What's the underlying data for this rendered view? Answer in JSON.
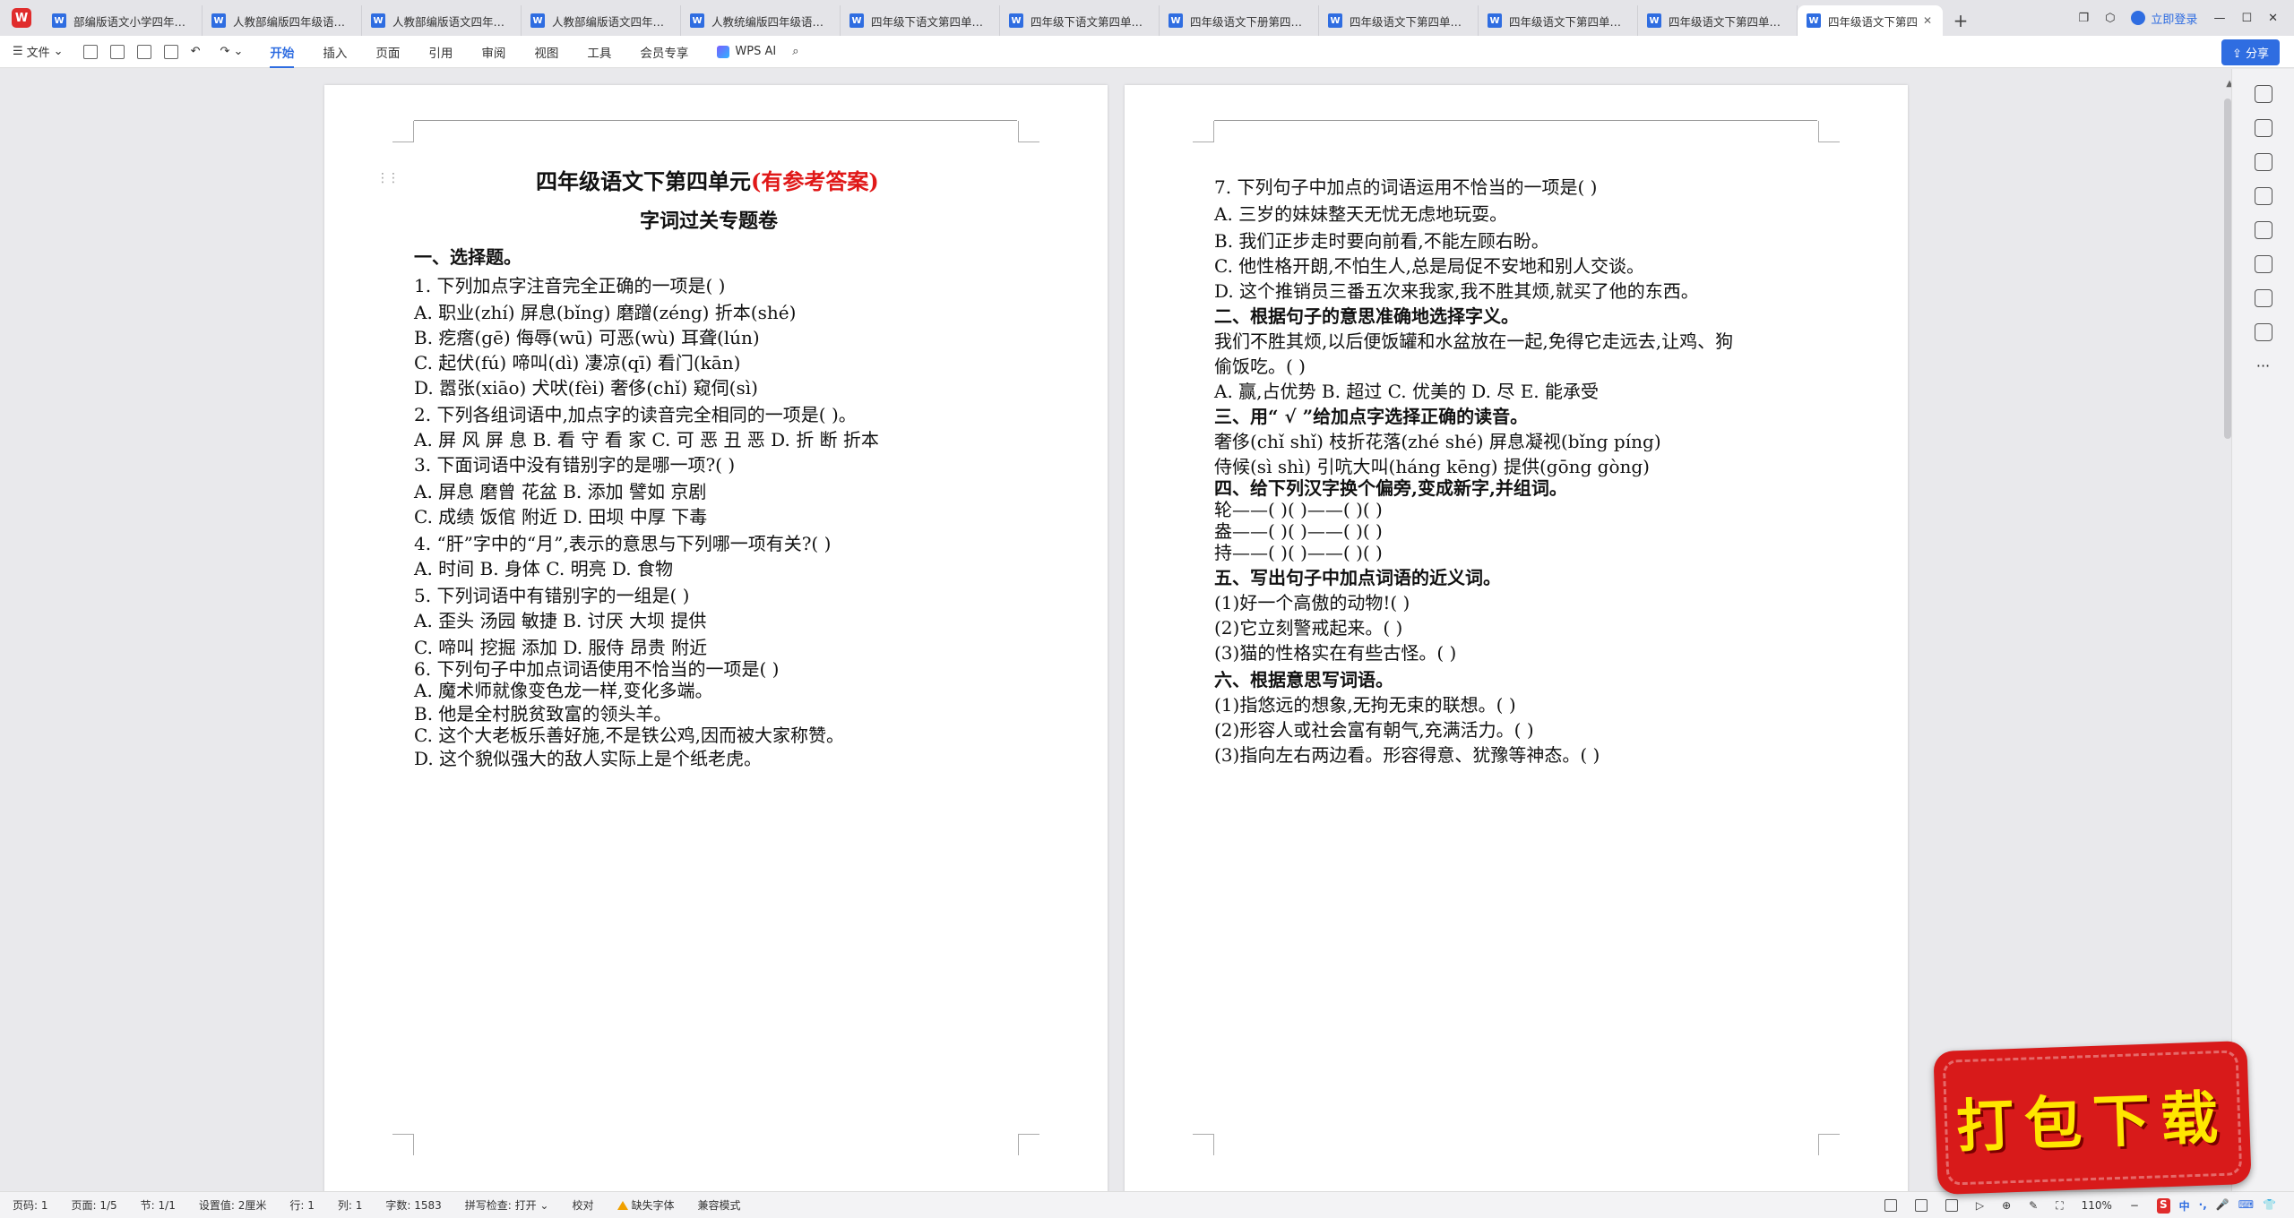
{
  "tabs": [
    "部编版语文小学四年级下",
    "人教部编版四年级语文下",
    "人教部编版语文四年级下",
    "人教部编版语文四年级下",
    "人教统编版四年级语文下",
    "四年级下语文第四单元字",
    "四年级下语文第四单元综",
    "四年级语文下册第四单元",
    "四年级语文下第四单元综",
    "四年级语文下第四单元课",
    "四年级语文下第四单元课"
  ],
  "active_tab": "四年级语文下第四",
  "tabbar_right": {
    "login": "立即登录"
  },
  "toolbar": {
    "file": "文件",
    "menus": [
      "开始",
      "插入",
      "页面",
      "引用",
      "审阅",
      "视图",
      "工具",
      "会员专享"
    ],
    "wps_ai": "WPS AI",
    "share": "分享"
  },
  "page1": {
    "title_main": "四年级语文下第四单元",
    "title_red": "(有参考答案)",
    "subtitle": "字词过关专题卷",
    "lines": [
      "一、选择题。",
      "1. 下列加点字注音完全正确的一项是(          )",
      "A. 职业(zhí)    屏息(bǐng)    磨蹭(zéng)    折本(shé)",
      "B. 疙瘩(gē)     侮辱(wū)      可恶(wù)      耳聋(lún)",
      "C. 起伏(fú)     啼叫(dì)      凄凉(qī)      看门(kān)",
      "D. 嚣张(xiāo)   犬吠(fèi)     奢侈(chǐ)     窥伺(sì)",
      "2. 下列各组词语中,加点字的读音完全相同的一项是(      )。",
      "A. 屏 风  屏 息  B. 看 守  看 家  C. 可 恶  丑 恶  D. 折 断  折本",
      "3. 下面词语中没有错别字的是哪一项?(        )",
      "A. 屏息   磨曾   花盆          B. 添加   譬如   京剧",
      "C. 成绩   饭倌   附近          D. 田坝   中厚   下毒",
      "4. “肝”字中的“月”,表示的意思与下列哪一项有关?(        )",
      "A. 时间            B. 身体          C. 明亮           D. 食物",
      "5. 下列词语中有错别字的一组是(          )",
      "A. 歪头    汤园      敏捷 B. 讨厌    大坝      提供",
      "C. 啼叫    挖掘      添加 D. 服侍    昂贵      附近",
      "6. 下列句子中加点词语使用不恰当的一项是(      )",
      "A. 魔术师就像变色龙一样,变化多端。",
      "B. 他是全村脱贫致富的领头羊。",
      "C. 这个大老板乐善好施,不是铁公鸡,因而被大家称赞。",
      "D. 这个貌似强大的敌人实际上是个纸老虎。"
    ]
  },
  "page2": {
    "lines": [
      "7. 下列句子中加点的词语运用不恰当的一项是(        )",
      "A. 三岁的妹妹整天无忧无虑地玩耍。",
      "B. 我们正步走时要向前看,不能左顾右盼。",
      "C. 他性格开朗,不怕生人,总是局促不安地和别人交谈。",
      "D. 这个推销员三番五次来我家,我不胜其烦,就买了他的东西。",
      "二、根据句子的意思准确地选择字义。",
      "    我们不胜其烦,以后便饭罐和水盆放在一起,免得它走远去,让鸡、狗",
      "偷饭吃。(        )",
      "A. 赢,占优势 B. 超过 C. 优美的 D. 尽 E. 能承受",
      "三、用“ √ ”给加点字选择正确的读音。",
      "奢侈(chǐ   shǐ)     枝折花落(zhé    shé)     屏息凝视(bǐng   píng)",
      "侍候(sì   shì)      引吭大叫(háng    kēng)  提供(gōng   gòng)",
      "四、给下列汉字换个偏旁,变成新字,并组词。",
      "轮——(       )(           )——(       )(           )",
      "盎——(       )(           )——(       )(           )",
      "持——(       )(           )——(       )(           )",
      "五、写出句子中加点词语的近义词。",
      "(1)好一个高傲的动物!(          )",
      "(2)它立刻警戒起来。(          )",
      "(3)猫的性格实在有些古怪。(          )",
      "六、根据意思写词语。",
      "(1)指悠远的想象,无拘无束的联想。(      )",
      "(2)形容人或社会富有朝气,充满活力。(      )",
      "(3)指向左右两边看。形容得意、犹豫等神态。(      )"
    ]
  },
  "statusbar": {
    "page": "页码: 1",
    "pages": "页面: 1/5",
    "section": "节: 1/1",
    "setting": "设置值: 2厘米",
    "row": "行: 1",
    "col": "列: 1",
    "words": "字数: 1583",
    "spell": "拼写检查: 打开",
    "proof": "校对",
    "missing_font": "缺失字体",
    "compat": "兼容模式",
    "zoom": "110%",
    "ime": [
      "中",
      "·,",
      "🎤",
      "⌨",
      "👕"
    ]
  },
  "badge": {
    "text": "打包下载"
  }
}
